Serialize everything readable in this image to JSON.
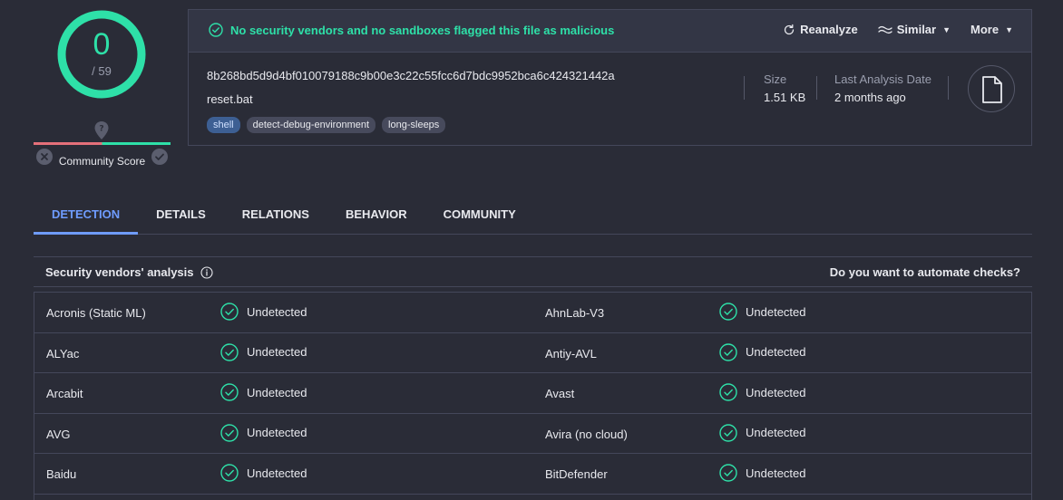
{
  "score": {
    "detected": "0",
    "total": "/ 59",
    "ring_color": "#2ee0a8"
  },
  "community": {
    "label": "Community Score"
  },
  "card": {
    "verdict": "No security vendors and no sandboxes flagged this file as malicious",
    "actions": {
      "reanalyze": "Reanalyze",
      "similar": "Similar",
      "more": "More"
    },
    "hash": "8b268bd5d9d4bf010079188c9b00e3c22c55fcc6d7bdc9952bca6c424321442a",
    "filename": "reset.bat",
    "tags": [
      "shell",
      "detect-debug-environment",
      "long-sleeps"
    ],
    "size_label": "Size",
    "size_value": "1.51 KB",
    "date_label": "Last Analysis Date",
    "date_value": "2 months ago"
  },
  "tabs": [
    "DETECTION",
    "DETAILS",
    "RELATIONS",
    "BEHAVIOR",
    "COMMUNITY"
  ],
  "analysis": {
    "title": "Security vendors' analysis",
    "automate": "Do you want to automate checks?"
  },
  "vendors": [
    {
      "left": "Acronis (Static ML)",
      "left_result": "Undetected",
      "right": "AhnLab-V3",
      "right_result": "Undetected"
    },
    {
      "left": "ALYac",
      "left_result": "Undetected",
      "right": "Antiy-AVL",
      "right_result": "Undetected"
    },
    {
      "left": "Arcabit",
      "left_result": "Undetected",
      "right": "Avast",
      "right_result": "Undetected"
    },
    {
      "left": "AVG",
      "left_result": "Undetected",
      "right": "Avira (no cloud)",
      "right_result": "Undetected"
    },
    {
      "left": "Baidu",
      "left_result": "Undetected",
      "right": "BitDefender",
      "right_result": "Undetected"
    }
  ],
  "colors": {
    "accent": "#6f9cff",
    "ok": "#2ee0a8",
    "bg": "#2a2c37"
  }
}
